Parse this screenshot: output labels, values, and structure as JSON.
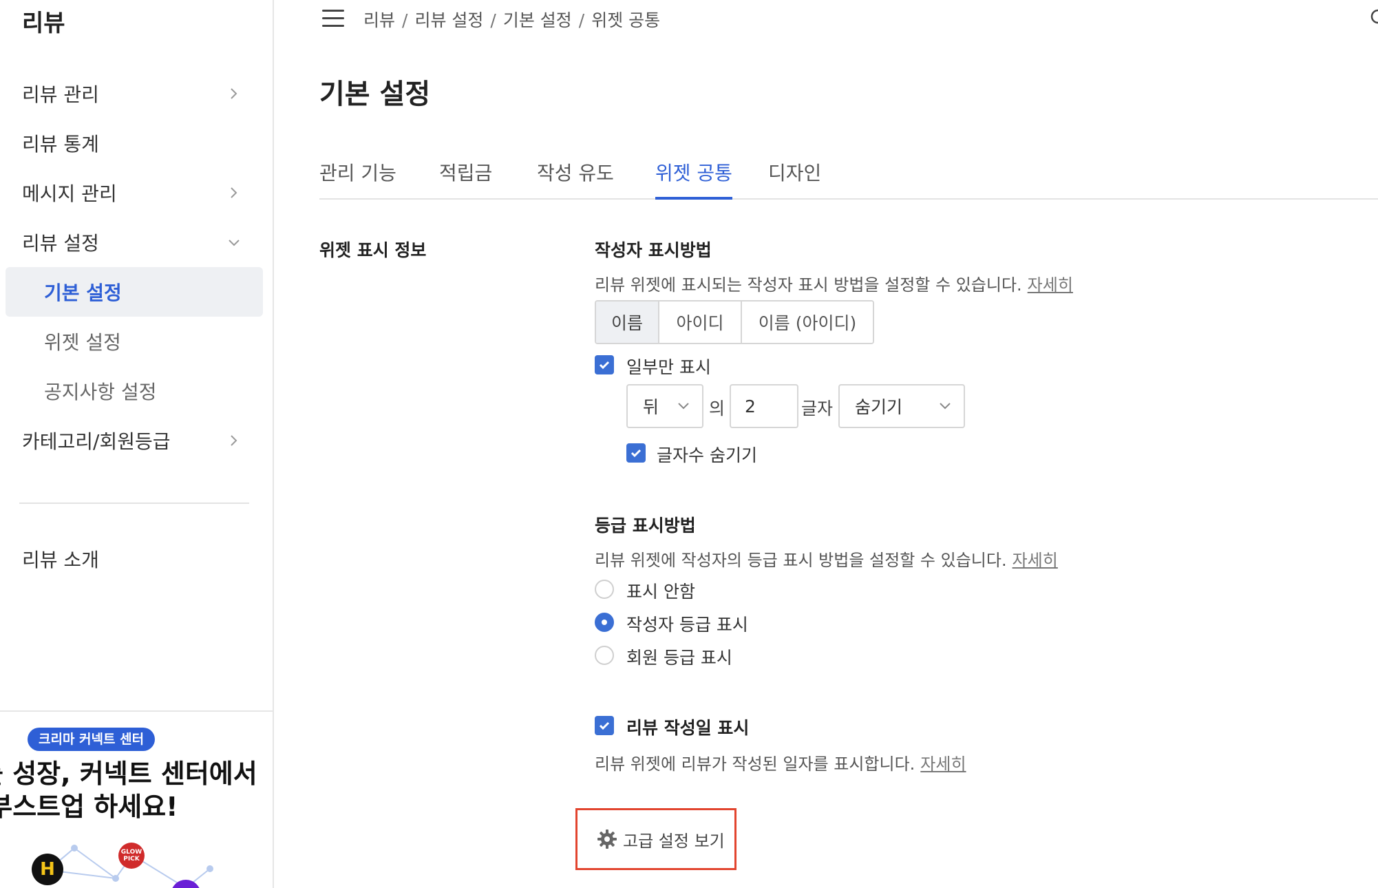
{
  "sidebar": {
    "brand": "리뷰",
    "items": [
      {
        "label": "리뷰 관리"
      },
      {
        "label": "리뷰 통계"
      },
      {
        "label": "메시지 관리"
      },
      {
        "label": "리뷰 설정"
      },
      {
        "label": "기본 설정"
      },
      {
        "label": "위젯 설정"
      },
      {
        "label": "공지사항 설정"
      },
      {
        "label": "카테고리/회원등급"
      },
      {
        "label": "리뷰 소개"
      }
    ],
    "promo": {
      "badge": "크리마 커넥트 센터",
      "title": "를 성장, 커넥트 센터에서\n 부스트업 하세요!",
      "logo_h": "H",
      "logo_glow": "GLOW PICK"
    }
  },
  "header": {
    "breadcrumb": [
      "리뷰",
      "리뷰 설정",
      "기본 설정",
      "위젯 공통"
    ]
  },
  "page_title": "기본 설정",
  "tabs": [
    {
      "label": "관리 기능"
    },
    {
      "label": "적립금"
    },
    {
      "label": "작성 유도"
    },
    {
      "label": "위젯 공통"
    },
    {
      "label": "디자인"
    }
  ],
  "section": {
    "label": "위젯 표시 정보",
    "author": {
      "title": "작성자 표시방법",
      "desc": "리뷰 위젯에 표시되는 작성자 표시 방법을 설정할 수 있습니다.",
      "more": "자세히",
      "options": [
        "이름",
        "아이디",
        "이름 (아이디)"
      ],
      "selected": "이름",
      "partial_label": "일부만 표시",
      "position_select": "뒤",
      "of_text": "의",
      "count_value": "2",
      "chars_text": "글자",
      "mode_select": "숨기기",
      "hide_count_label": "글자수 숨기기"
    },
    "grade": {
      "title": "등급 표시방법",
      "desc": "리뷰 위젯에 작성자의 등급 표시 방법을 설정할 수 있습니다.",
      "more": "자세히",
      "options": [
        "표시 안함",
        "작성자 등급 표시",
        "회원 등급 표시"
      ],
      "selected": "작성자 등급 표시"
    },
    "date": {
      "label": "리뷰 작성일 표시",
      "desc": "리뷰 위젯에 리뷰가 작성된 일자를 표시합니다.",
      "more": "자세히"
    },
    "advanced_label": "고급 설정 보기"
  },
  "colors": {
    "accent": "#2e5fd6",
    "checkbox": "#3b6fd4",
    "highlight_border": "#e2452f"
  }
}
